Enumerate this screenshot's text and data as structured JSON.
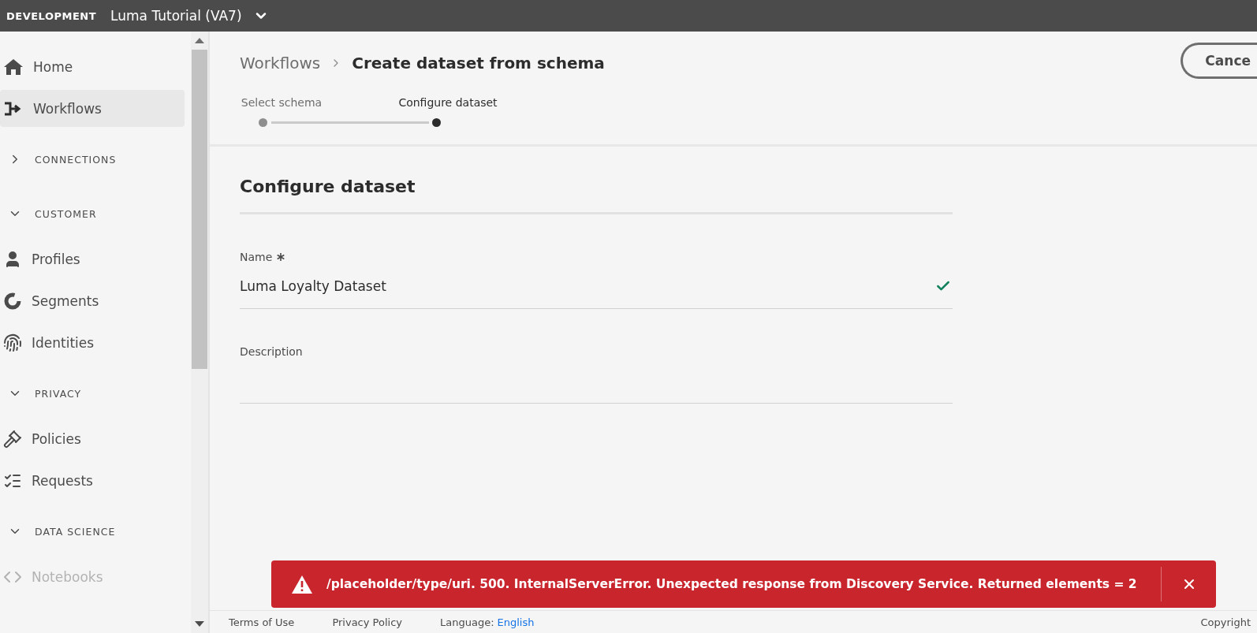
{
  "top_bar": {
    "environment": "DEVELOPMENT",
    "sandbox": "Luma Tutorial (VA7)"
  },
  "sidebar": {
    "items": [
      {
        "kind": "item",
        "label": "Home",
        "selected": false,
        "disabled": false
      },
      {
        "kind": "item",
        "label": "Workflows",
        "selected": true,
        "disabled": false
      },
      {
        "kind": "section",
        "label": "CONNECTIONS",
        "expanded": false
      },
      {
        "kind": "section",
        "label": "CUSTOMER",
        "expanded": true,
        "children": [
          {
            "kind": "item",
            "label": "Profiles",
            "selected": false,
            "disabled": false
          },
          {
            "kind": "item",
            "label": "Segments",
            "selected": false,
            "disabled": false
          },
          {
            "kind": "item",
            "label": "Identities",
            "selected": false,
            "disabled": false
          }
        ]
      },
      {
        "kind": "section",
        "label": "PRIVACY",
        "expanded": true,
        "children": [
          {
            "kind": "item",
            "label": "Policies",
            "selected": false,
            "disabled": false
          },
          {
            "kind": "item",
            "label": "Requests",
            "selected": false,
            "disabled": false
          }
        ]
      },
      {
        "kind": "section",
        "label": "DATA SCIENCE",
        "expanded": true,
        "children": [
          {
            "kind": "item",
            "label": "Notebooks",
            "selected": false,
            "disabled": true
          }
        ]
      }
    ]
  },
  "breadcrumb": [
    "Workflows",
    "Create dataset from schema"
  ],
  "cancel_button": "Cance",
  "steps": [
    {
      "label": "Select schema",
      "selected": false
    },
    {
      "label": "Configure dataset",
      "selected": true
    }
  ],
  "form": {
    "title": "Configure dataset",
    "fields": [
      {
        "label": "Name",
        "required": true,
        "value": "Luma Loyalty Dataset",
        "valid": true
      },
      {
        "label": "Description",
        "required": false,
        "valid": false
      }
    ]
  },
  "toast": {
    "message": "/placeholder/type/uri. 500. InternalServerError. Unexpected response from Discovery Service. Returned elements = 2"
  },
  "footer": {
    "links": [
      "Terms of Use",
      "Privacy Policy"
    ],
    "language_label": "Language:",
    "language": "English",
    "copyright": "Copyright"
  }
}
